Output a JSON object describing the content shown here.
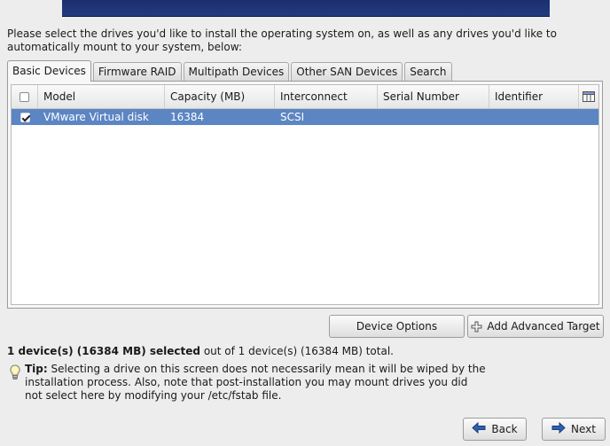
{
  "prompt": "Please select the drives you'd like to install the operating system on, as well as any drives you'd like to automatically mount to your system, below:",
  "tabs": [
    "Basic Devices",
    "Firmware RAID",
    "Multipath Devices",
    "Other SAN Devices",
    "Search"
  ],
  "active_tab": "Basic Devices",
  "table": {
    "columns": [
      "Model",
      "Capacity (MB)",
      "Interconnect",
      "Serial Number",
      "Identifier"
    ],
    "rows": [
      {
        "checked": true,
        "selected": true,
        "cells": [
          "VMware Virtual disk",
          "16384",
          "SCSI",
          "",
          ""
        ]
      }
    ]
  },
  "buttons": {
    "device_options": "Device Options",
    "add_advanced_target": "Add Advanced Target",
    "back": "Back",
    "next": "Next"
  },
  "summary": {
    "bold": "1 device(s) (16384 MB) selected",
    "rest": " out of 1 device(s) (16384 MB) total."
  },
  "tip": {
    "label": "Tip:",
    "text": " Selecting a drive on this screen does not necessarily mean it will be wiped by the installation process.  Also, note that post-installation you may mount drives you did not select here by modifying your /etc/fstab file."
  },
  "colors": {
    "selection": "#5b85c3",
    "banner": "#1b2f6e",
    "arrow": "#2f5fb0"
  }
}
